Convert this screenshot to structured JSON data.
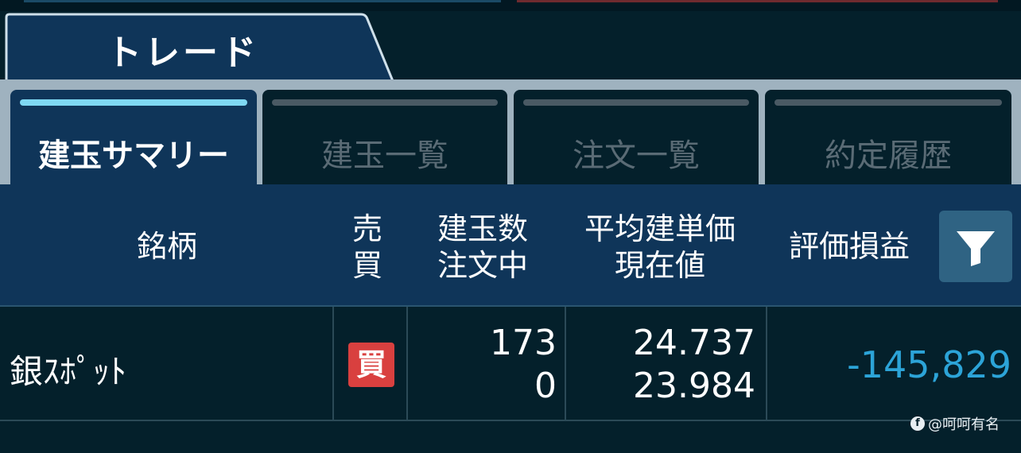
{
  "main_tab": {
    "label": "トレード"
  },
  "subtabs": [
    {
      "label": "建玉サマリー",
      "active": true
    },
    {
      "label": "建玉一覧",
      "active": false
    },
    {
      "label": "注文一覧",
      "active": false
    },
    {
      "label": "約定履歴",
      "active": false
    }
  ],
  "table": {
    "headers": {
      "symbol": "銘柄",
      "side_line1": "売",
      "side_line2": "買",
      "qty_line1": "建玉数",
      "qty_line2": "注文中",
      "price_line1": "平均建単価",
      "price_line2": "現在値",
      "pl": "評価損益"
    },
    "filter_icon": "filter-icon",
    "rows": [
      {
        "symbol": "銀ｽﾎﾟｯﾄ",
        "side": "買",
        "position_qty": "173",
        "ordering_qty": "0",
        "avg_price": "24.737",
        "current_price": "23.984",
        "pl": "-145,829"
      }
    ]
  },
  "watermark": {
    "text": "@呵呵有名"
  },
  "colors": {
    "background": "#04202b",
    "header_bg": "#0f3559",
    "active_tab_indicator": "#7fd8f2",
    "buy_badge": "#d9403f",
    "negative_pl": "#2ca4d8",
    "filter_button": "#2f6383"
  }
}
